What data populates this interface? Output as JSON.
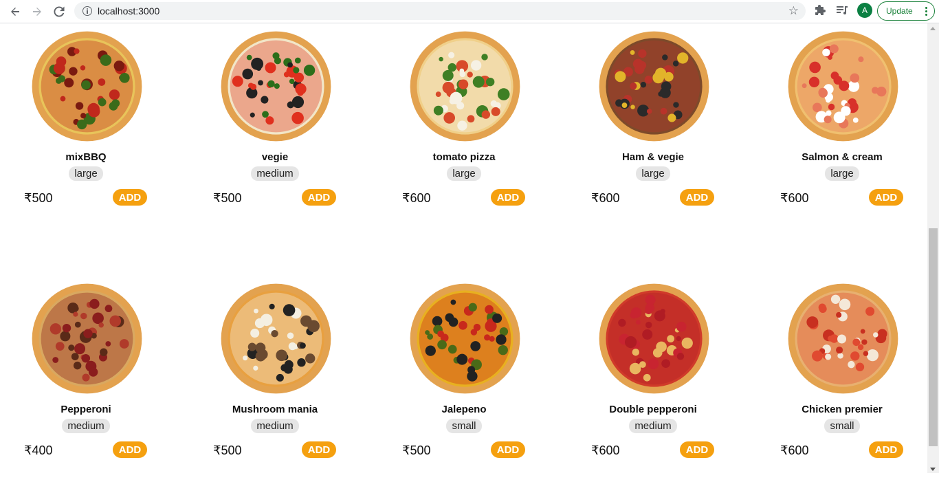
{
  "browser": {
    "url": "localhost:3000",
    "profile_initial": "A",
    "update_label": "Update"
  },
  "menu": [
    {
      "name": "mixBBQ",
      "size": "large",
      "price": "₹500",
      "add_label": "ADD"
    },
    {
      "name": "vegie",
      "size": "medium",
      "price": "₹500",
      "add_label": "ADD"
    },
    {
      "name": "tomato pizza",
      "size": "large",
      "price": "₹600",
      "add_label": "ADD"
    },
    {
      "name": "Ham & vegie",
      "size": "large",
      "price": "₹600",
      "add_label": "ADD"
    },
    {
      "name": "Salmon & cream",
      "size": "large",
      "price": "₹600",
      "add_label": "ADD"
    },
    {
      "name": "Pepperoni",
      "size": "medium",
      "price": "₹400",
      "add_label": "ADD"
    },
    {
      "name": "Mushroom mania",
      "size": "medium",
      "price": "₹500",
      "add_label": "ADD"
    },
    {
      "name": "Jalepeno",
      "size": "small",
      "price": "₹500",
      "add_label": "ADD"
    },
    {
      "name": "Double pepperoni",
      "size": "medium",
      "price": "₹600",
      "add_label": "ADD"
    },
    {
      "name": "Chicken premier",
      "size": "small",
      "price": "₹600",
      "add_label": "ADD"
    }
  ],
  "colors": {
    "accent": "#f5a00f",
    "chip": "#e5e5e5",
    "crust": "#e3a24f"
  }
}
